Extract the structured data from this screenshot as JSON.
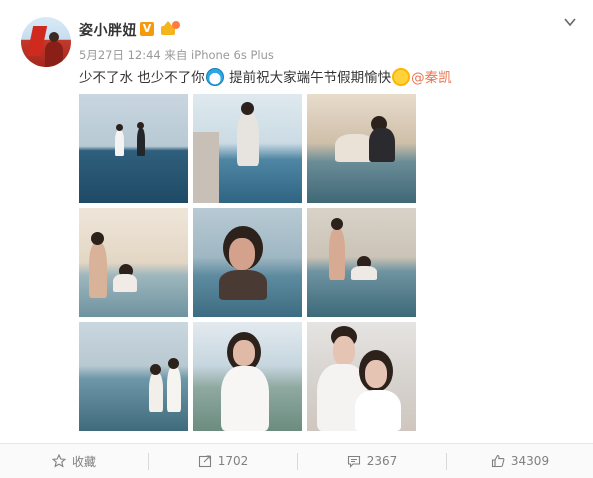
{
  "post": {
    "author": "姿小胖妞",
    "verified_badge": "V",
    "timestamp": "5月27日 12:44",
    "source": "来自 iPhone 6s Plus",
    "text_part1": "少不了水 也少不了你",
    "text_part2": "提前祝大家端午节假期愉快",
    "mention": "@秦凯"
  },
  "photos": [
    {
      "name": "photo-1"
    },
    {
      "name": "photo-2"
    },
    {
      "name": "photo-3"
    },
    {
      "name": "photo-4"
    },
    {
      "name": "photo-5"
    },
    {
      "name": "photo-6"
    },
    {
      "name": "photo-7"
    },
    {
      "name": "photo-8"
    },
    {
      "name": "photo-9"
    }
  ],
  "actions": {
    "favorite_label": "收藏",
    "repost_count": "1702",
    "comment_count": "2367",
    "like_count": "34309"
  },
  "colors": {
    "mention": "#eb7350",
    "verified": "#f69a0b",
    "meta": "#999999"
  },
  "icons": {
    "expand": "chevron-down-icon",
    "favorite": "star-icon",
    "repost": "share-icon",
    "comment": "comment-icon",
    "like": "thumbs-up-icon"
  }
}
